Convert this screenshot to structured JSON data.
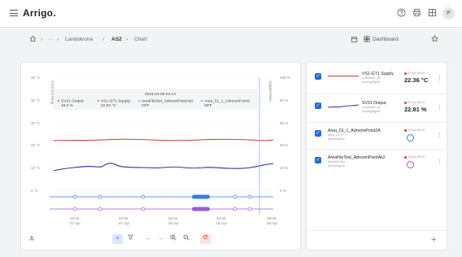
{
  "app": {
    "title": "Arrigo."
  },
  "topbar": {
    "help_icon": "help-icon",
    "printer_icon": "printer-icon",
    "grid_icon": "grid-icon",
    "avatar_initials": "P"
  },
  "breadcrumb": {
    "items": [
      "Landskrona",
      "AS2",
      "Chart"
    ],
    "ellipsis": "···",
    "separator": "›",
    "dashboard_label": "Dashboard"
  },
  "chart": {
    "left_ticks": [
      "30 °C",
      "40 °C",
      "30 °C",
      "20 °C",
      "10 °C",
      "0 °C"
    ],
    "right_ticks": [
      "100 %",
      "80 %",
      "60 %",
      "40 %",
      "20 %",
      "0 %"
    ],
    "left_axis_label": "SY(CO2)Temp",
    "right_axis_label": "Output/Valve",
    "x_ticks": [
      {
        "time": "22:00",
        "date": "07 Apr"
      },
      {
        "time": "04:00",
        "date": "07 Apr"
      },
      {
        "time": "20:45",
        "date": "06 Apr"
      },
      {
        "time": "10:40",
        "date": "08 Apr"
      },
      {
        "time": "08:00",
        "date": "08 Apr"
      }
    ],
    "tooltip": {
      "timestamp": "2021-04-09 04:13",
      "entries": [
        {
          "name": "SV31 Output",
          "value": "18.0 %",
          "color": "#2e2e8a"
        },
        {
          "name": "VS1-GT1 Supply",
          "value": "22.93 °C",
          "color": "#c93a3a"
        },
        {
          "name": "AreaFileSet_AdroomPointAk2",
          "value": "OFF",
          "color": "#9a5cd6"
        },
        {
          "name": "Area_01_1_AdroomPoint2",
          "value": "OFF",
          "color": "#3b7be4"
        }
      ]
    }
  },
  "toolbar": {
    "buttons": [
      "calendar-icon",
      "x-icon",
      "filter-icon",
      "arrow-left-icon",
      "arrow-right-icon",
      "zoom-in-icon",
      "zoom-out-icon",
      "refresh-icon"
    ]
  },
  "series": [
    {
      "name": "VS1-GT1 Supply",
      "sub1": "Controller_AI",
      "sub2": "AnalogSignal",
      "timestamp": "09 Apr 08:00",
      "value": "22.36 °C",
      "color": "#c93a3a",
      "kind": "line"
    },
    {
      "name": "SV31 Output",
      "sub1": "Controller_A1",
      "sub2": "AnalogSignal",
      "timestamp": "09 Apr 08:00",
      "value": "22.81 %",
      "color": "#2e2e8a",
      "kind": "line"
    },
    {
      "name": "Area_01_1_AdroomPoint2A",
      "sub1": "Area_01_1",
      "sub2": "AlarmSignal",
      "timestamp": "09 Apr 08:00",
      "value": "",
      "color": "#3b7be4",
      "kind": "ring"
    },
    {
      "name": "AreaFileTest_AdroomPointAk2",
      "sub1": "AreaFileTest",
      "sub2": "AlarmSignal",
      "timestamp": "09 Apr 08:00",
      "value": "",
      "color": "#9a5cd6",
      "kind": "ring"
    }
  ],
  "list": {
    "add_label": "+"
  }
}
